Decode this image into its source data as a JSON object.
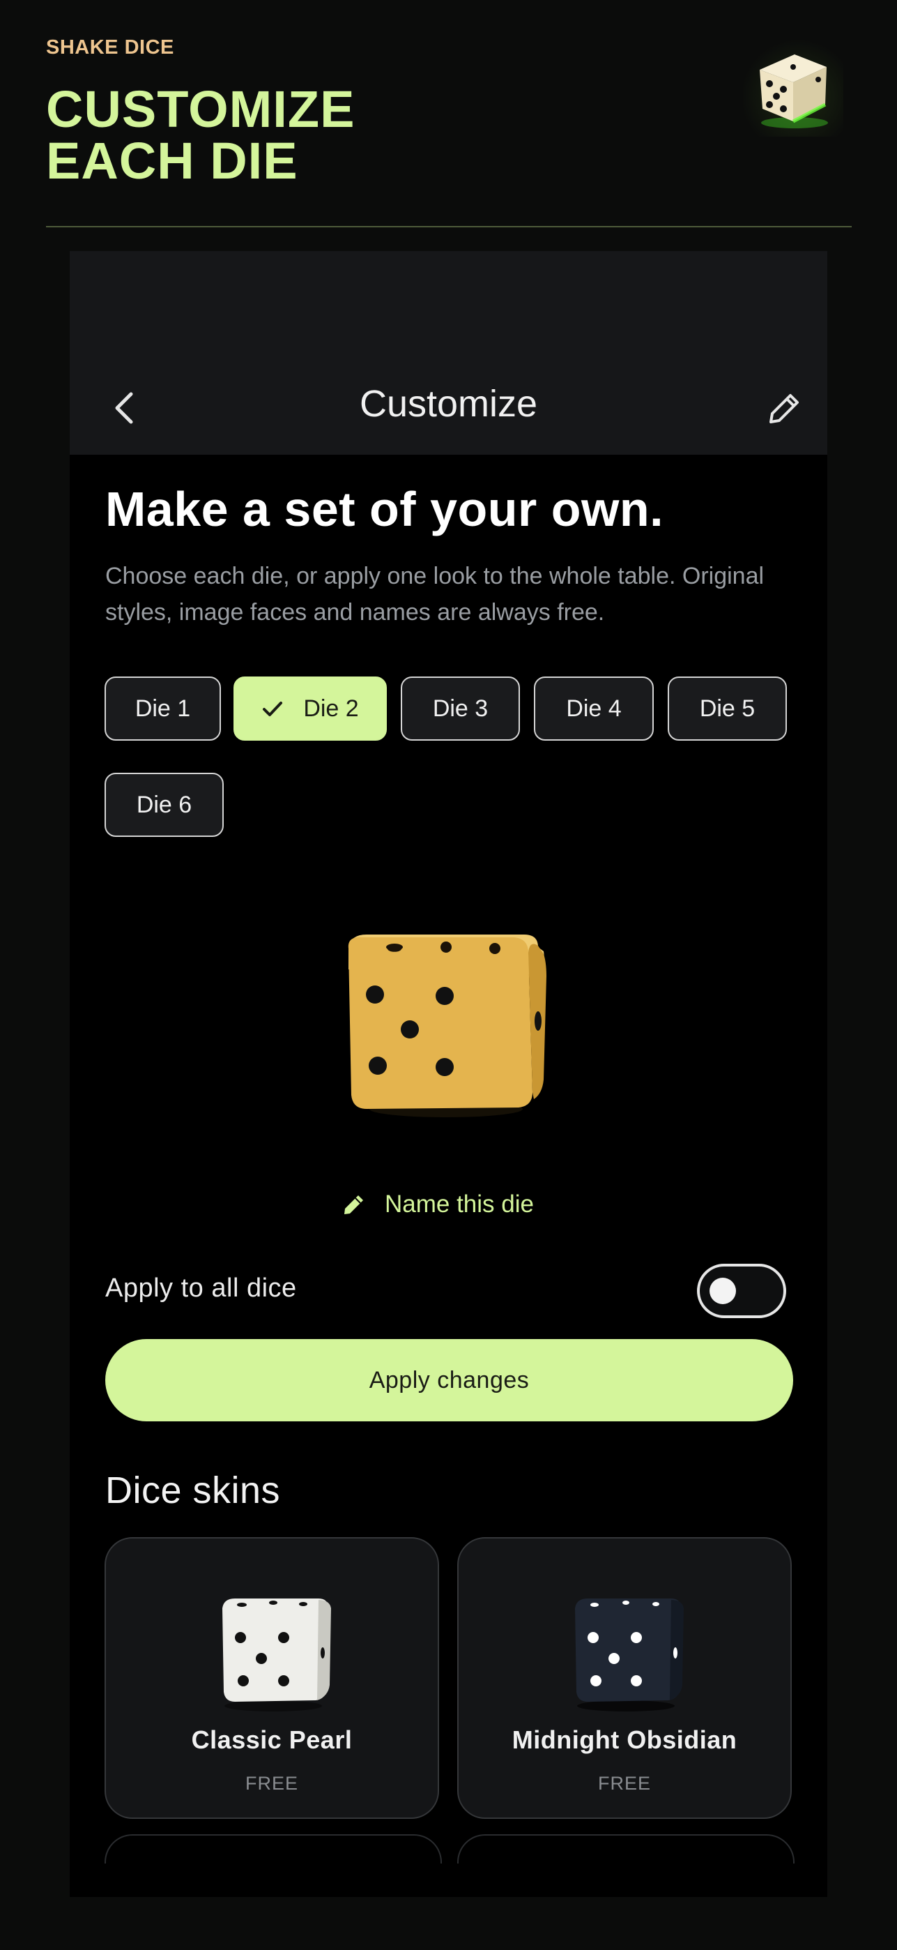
{
  "page": {
    "brand": "SHAKE DICE",
    "headline_line1": "CUSTOMIZE",
    "headline_line2": "EACH DIE",
    "hero_icon": "glowing-die-icon"
  },
  "app": {
    "title": "Customize",
    "back_icon": "chevron-left-icon",
    "edit_icon": "pencil-icon"
  },
  "intro": {
    "heading": "Make a set of your own.",
    "description": "Choose each die, or apply one look to the whole table. Original styles, image faces and names are always free."
  },
  "dice_tabs": [
    {
      "label": "Die 1",
      "selected": false
    },
    {
      "label": "Die 2",
      "selected": true
    },
    {
      "label": "Die 3",
      "selected": false
    },
    {
      "label": "Die 4",
      "selected": false
    },
    {
      "label": "Die 5",
      "selected": false
    },
    {
      "label": "Die 6",
      "selected": false
    }
  ],
  "preview": {
    "die_color": "#e4b44e",
    "name_link": "Name this die"
  },
  "apply_all": {
    "label": "Apply to all dice",
    "enabled": false
  },
  "apply_button": "Apply changes",
  "skins": {
    "title": "Dice skins",
    "items": [
      {
        "name": "Classic Pearl",
        "price": "FREE",
        "color": "#eeeeea",
        "pip": "#111111"
      },
      {
        "name": "Midnight Obsidian",
        "price": "FREE",
        "color": "#1f2633",
        "pip": "#ffffff"
      }
    ]
  },
  "colors": {
    "accent": "#d4f59b",
    "brand": "#eec58f",
    "background": "#0b0c0b"
  }
}
